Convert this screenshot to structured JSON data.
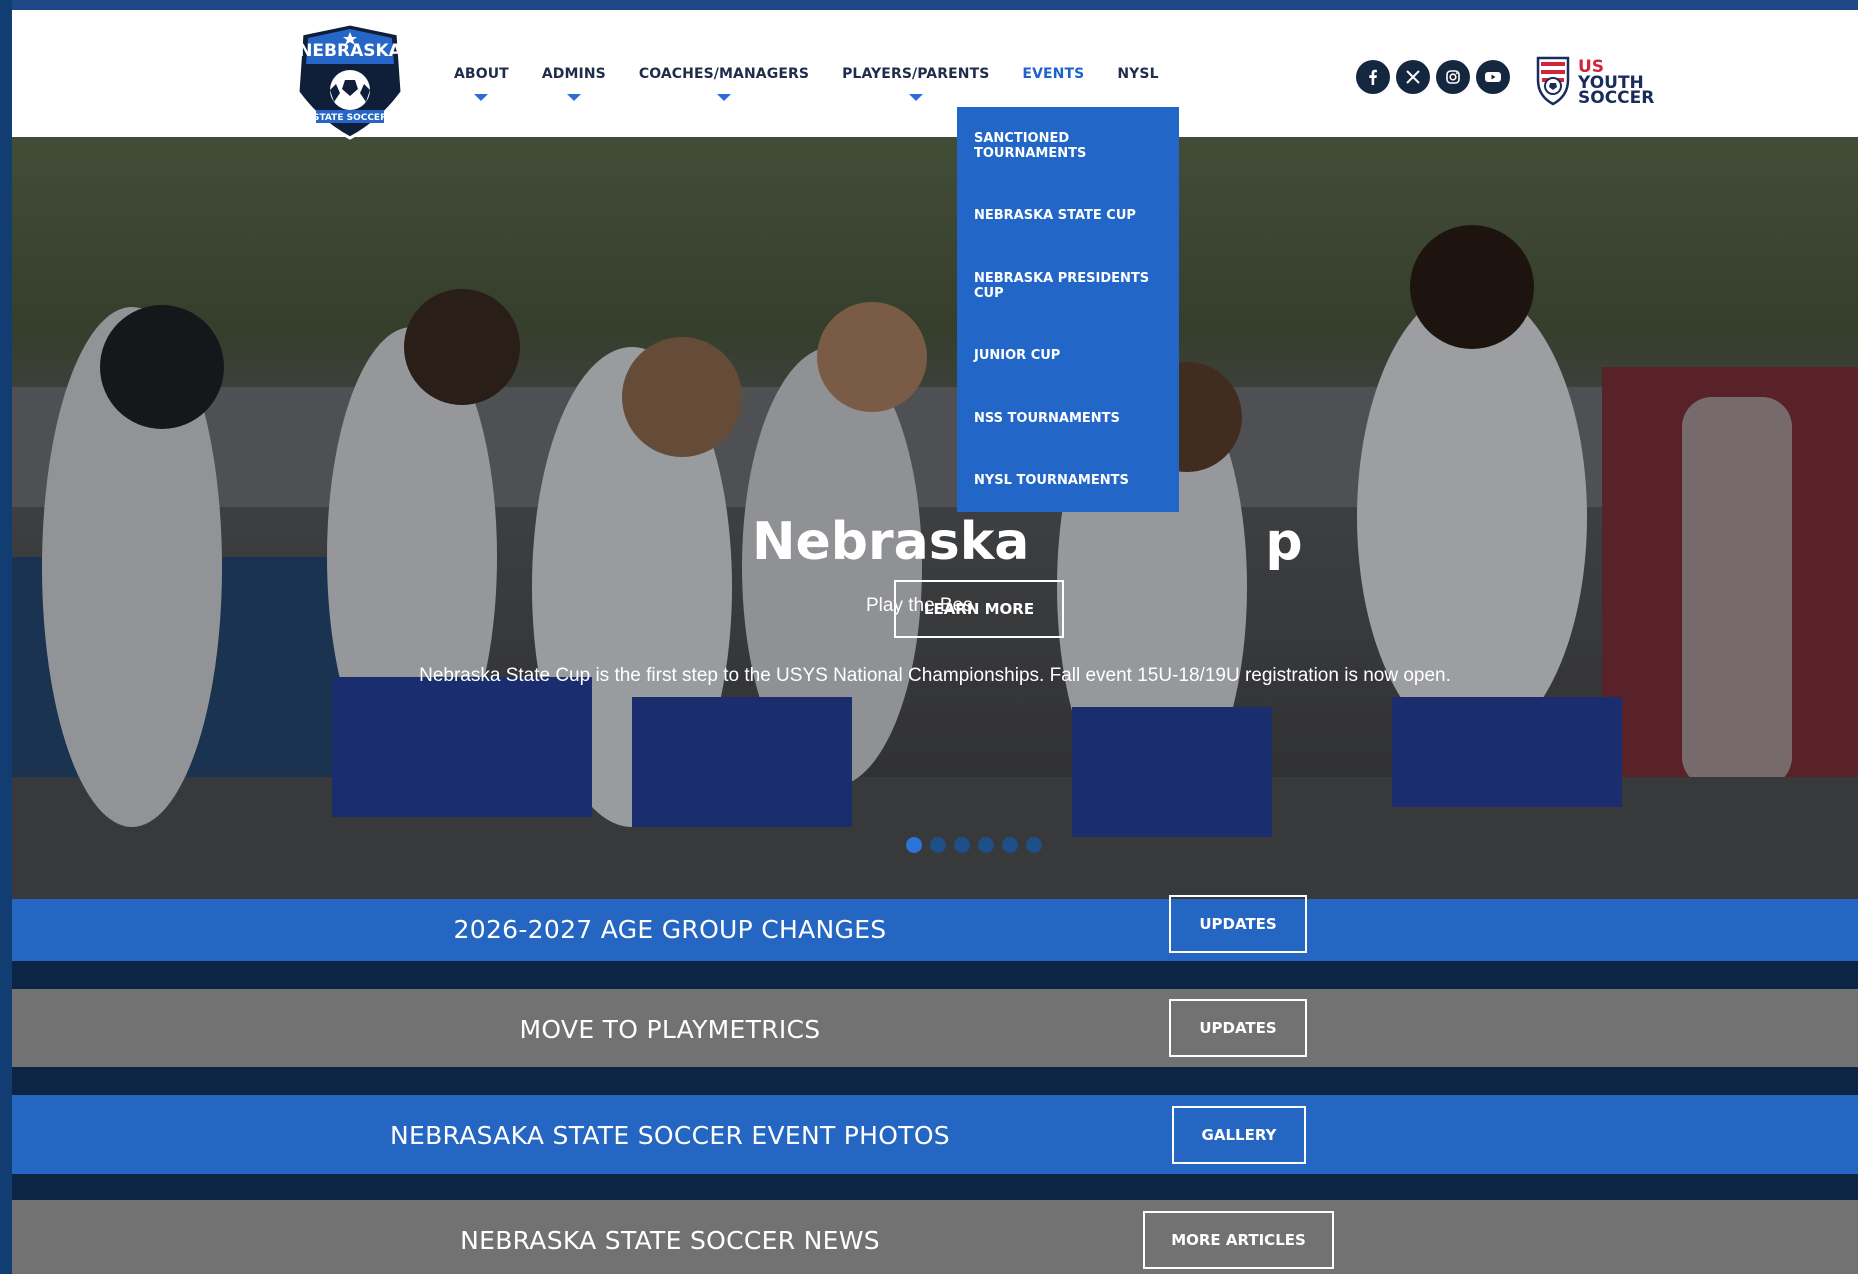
{
  "brand": {
    "logo_top_text": "NEBRASKA",
    "logo_bottom_text": "STATE SOCCER",
    "partner_logo_line1": "US",
    "partner_logo_line2": "YOUTH",
    "partner_logo_line3": "SOCCER",
    "colors": {
      "primary_blue": "#2466c1",
      "navy": "#15263f",
      "gray_band": "#727272",
      "accent_red": "#d0263a"
    }
  },
  "nav": {
    "items": [
      {
        "label": "ABOUT",
        "has_dropdown": true
      },
      {
        "label": "ADMINS",
        "has_dropdown": true
      },
      {
        "label": "COACHES/MANAGERS",
        "has_dropdown": true
      },
      {
        "label": "PLAYERS/PARENTS",
        "has_dropdown": true
      },
      {
        "label": "EVENTS",
        "active": true
      },
      {
        "label": "NYSL"
      }
    ]
  },
  "social": [
    "facebook-icon",
    "x-icon",
    "instagram-icon",
    "youtube-icon"
  ],
  "events_menu": {
    "items": [
      "SANCTIONED TOURNAMENTS",
      "NEBRASKA STATE CUP",
      "NEBRASKA PRESIDENTS CUP",
      "JUNIOR CUP",
      "NSS TOURNAMENTS",
      "NYSL TOURNAMENTS"
    ]
  },
  "hero": {
    "title_visible_left": "Nebraska",
    "title_visible_right": "p",
    "tagline_visible": "Play the Bes",
    "description": "Nebraska State Cup is the first step to the USYS National Championships. Fall event 15U-18/19U registration is now open.",
    "cta": "LEARN MORE",
    "slide_count": 6,
    "active_slide": 1
  },
  "bands": [
    {
      "title": "2026-2027 AGE GROUP CHANGES",
      "button": "UPDATES"
    },
    {
      "title": "MOVE TO PLAYMETRICS",
      "button": "UPDATES"
    },
    {
      "title": "NEBRASAKA STATE SOCCER EVENT PHOTOS",
      "button": "GALLERY"
    },
    {
      "title": "NEBRASKA STATE SOCCER NEWS",
      "button": "MORE ARTICLES"
    }
  ]
}
